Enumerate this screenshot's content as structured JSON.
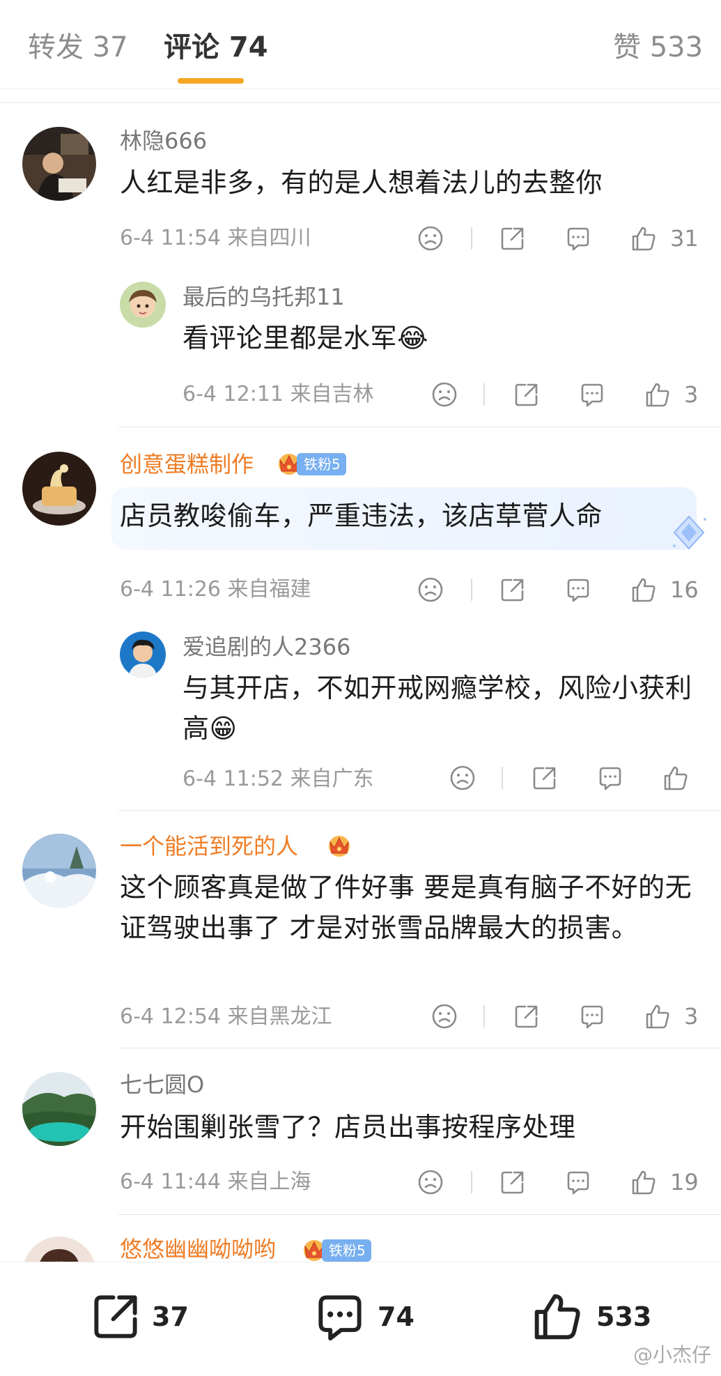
{
  "tabs": {
    "repost": "转发 37",
    "comments": "评论 74",
    "likes": "赞 533"
  },
  "comments": [
    {
      "user": "林隐666",
      "text": "人红是非多，有的是人想着法儿的去整你",
      "time": "6-4 11:54 来自四川",
      "likes": "31",
      "reply": {
        "user": "最后的乌托邦11",
        "text": "看评论里都是水军😂",
        "time": "6-4 12:11 来自吉林",
        "likes": "3"
      }
    },
    {
      "user": "创意蛋糕制作",
      "badge": "铁粉5",
      "text": "店员教唆偷车，严重违法，该店草菅人命",
      "time": "6-4 11:26 来自福建",
      "likes": "16",
      "reply": {
        "user": "爱追剧的人2366",
        "text": "与其开店，不如开戒网瘾学校，风险小获利高😁",
        "time": "6-4 11:52 来自广东",
        "likes": ""
      }
    },
    {
      "user": "一个能活到死的人",
      "text": "这个顾客真是做了件好事  要是真有脑子不好的无证驾驶出事了 才是对张雪品牌最大的损害。",
      "time": "6-4 12:54 来自黑龙江",
      "likes": "3"
    },
    {
      "user": "七七圆O",
      "text": "开始围剿张雪了？店员出事按程序处理",
      "time": "6-4 11:44 来自上海",
      "likes": "19"
    },
    {
      "user": "悠悠幽幽呦呦哟",
      "badge": "铁粉5"
    }
  ],
  "bottom": {
    "repost": "37",
    "comment": "74",
    "like": "533"
  },
  "watermark": "@小杰仔",
  "colors": {
    "accent": "#f6a623",
    "orange_name": "#ef7c24",
    "fan_badge": "#77aff0"
  }
}
